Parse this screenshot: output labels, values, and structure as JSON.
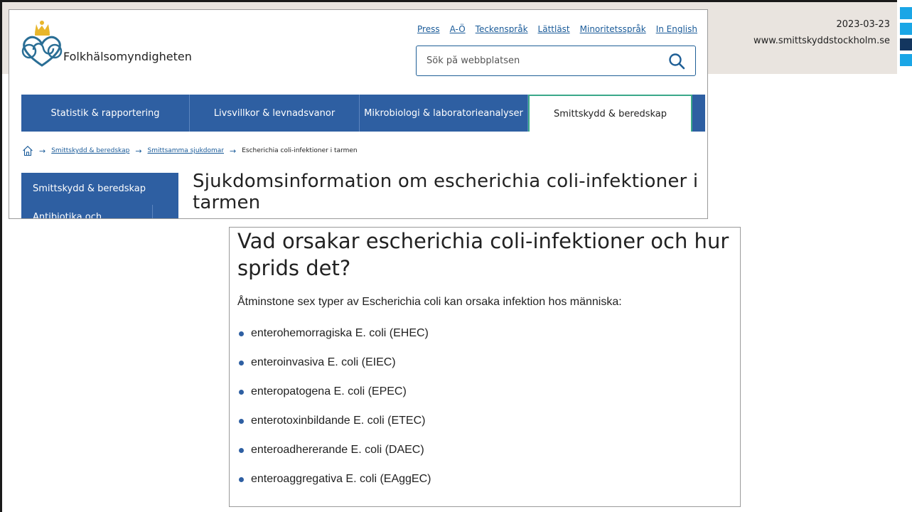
{
  "slide": {
    "date": "2023-03-23",
    "website": "www.smittskyddstockholm.se",
    "colors": {
      "band": "#e9e4df",
      "deco_light": "#1aa6e6",
      "deco_dark": "#13365f"
    }
  },
  "site_header": {
    "org_name": "Folkhälsomyndigheten",
    "top_links": [
      "Press",
      "A-Ö",
      "Teckenspråk",
      "Lättläst",
      "Minoritetsspråk",
      "In English"
    ],
    "search_placeholder": "Sök på webbplatsen"
  },
  "nav": {
    "items": [
      "Statistik & rapportering",
      "Livsvillkor & levnadsvanor",
      "Mikrobiologi & laboratorieanalyser",
      "Smittskydd & beredskap"
    ],
    "active_index": 3,
    "color": "#2e5fa2"
  },
  "breadcrumb": {
    "links": [
      "Smittskydd & beredskap",
      "Smittsamma sjukdomar"
    ],
    "current": "Escherichia coli-infektioner i tarmen"
  },
  "side_menu": {
    "active": "Smittskydd & beredskap",
    "next": "Antibiotika och"
  },
  "page": {
    "heading": "Sjukdomsinformation om escherichia coli-infektioner i tarmen"
  },
  "article": {
    "heading": "Vad orsakar escherichia coli-infektioner och hur sprids det?",
    "intro": "Åtminstone sex typer av Escherichia coli kan orsaka infektion hos människa:",
    "bullets": [
      "enterohemorragiska E. coli (EHEC)",
      "enteroinvasiva E. coli (EIEC)",
      "enteropatogena E. coli (EPEC)",
      "enterotoxinbildande E. coli (ETEC)",
      "enteroadhererande E. coli (DAEC)",
      "enteroaggregativa E. coli (EAggEC)"
    ]
  }
}
